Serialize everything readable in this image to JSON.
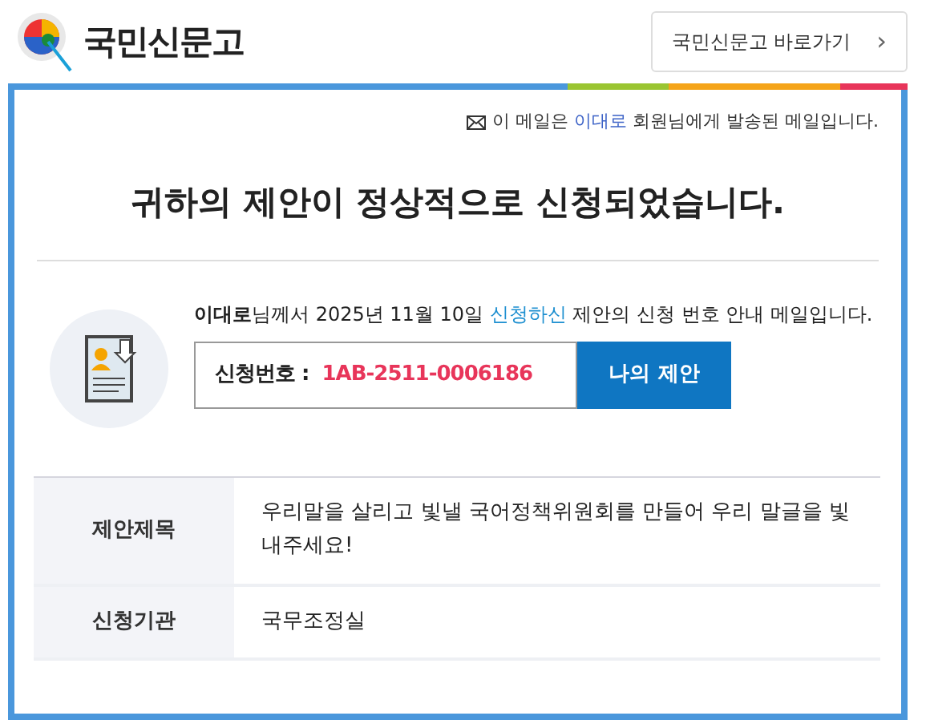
{
  "header": {
    "logo_text": "국민신문고",
    "link_button": {
      "label": "국민신문고 바로가기",
      "arrow": "›"
    }
  },
  "notice": {
    "before": "이 메일은 ",
    "name": "이대로",
    "after": " 회원님에게 발송된 메일입니다."
  },
  "title": "귀하의 제안이 정상적으로 신청되었습니다.",
  "intro": "**이대로**님께서 2025년 11월 10일 ",
  "intro_link": "신청하신",
  "intro_after": " 제안의 신청 번호 안내 메일입니다.",
  "application": {
    "label": "신청번호 :",
    "number": "1AB-2511-0006186",
    "button": "나의 제안"
  },
  "details": [
    {
      "label": "제안제목",
      "value": "우리말을 살리고 빛낼 국어정책위원회를 만들어 우리 말글을 빛내주세요!"
    },
    {
      "label": "신청기관",
      "value": "국무조정실"
    }
  ]
}
